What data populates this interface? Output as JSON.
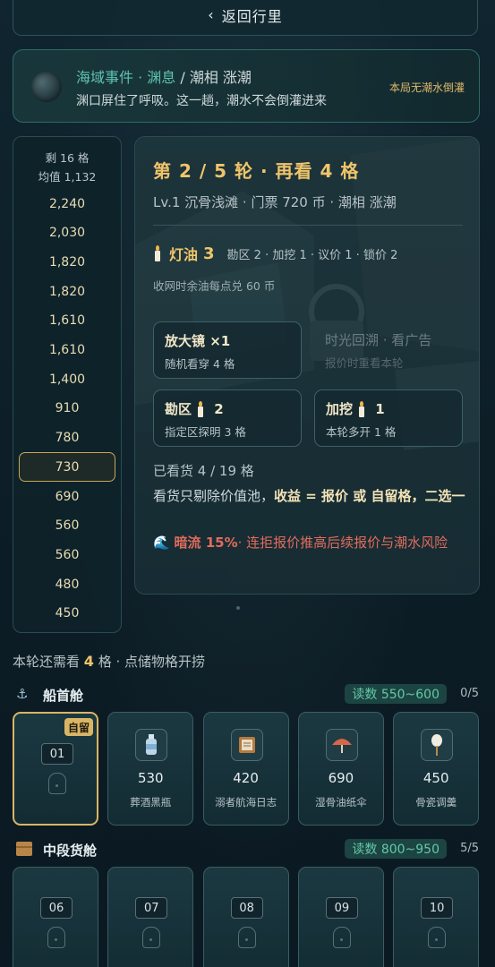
{
  "nav": {
    "back_label": "返回行里"
  },
  "event": {
    "title_prefix": "海域事件 · 渊息",
    "title_suffix": " / 潮相 涨潮",
    "desc": "渊口屏住了呼吸。这一趟，潮水不会倒灌进来",
    "side_note": "本局无潮水倒灌"
  },
  "price_column": {
    "remaining": "剩 16 格",
    "average": "均值 1,132",
    "prices": [
      "2,240",
      "2,030",
      "1,820",
      "1,820",
      "1,610",
      "1,610",
      "1,400",
      "910",
      "780",
      "730",
      "690",
      "560",
      "560",
      "480",
      "450"
    ],
    "selected_index": 9
  },
  "round": {
    "title": "第 2 / 5 轮 · 再看 4 格",
    "subtitle": "Lv.1 沉骨浅滩 · 门票 720 币 · 潮相 涨潮",
    "oil_label": "灯油",
    "oil_value": "3",
    "oil_costs": "勘区 2 · 加挖 1 · 议价 1 · 锁价 2",
    "oil_note": "收网时余油每点兑 60 币"
  },
  "tools": [
    {
      "title": "放大镜 ×1",
      "desc": "随机看穿 4 格",
      "cost": ""
    },
    {
      "title": "时光回溯 · 看广告",
      "desc": "报价时重看本轮",
      "cost": ""
    },
    {
      "title": "勘区",
      "desc": "指定区探明 3 格",
      "cost": "2"
    },
    {
      "title": "加挖",
      "desc": "本轮多开 1 格",
      "cost": "1"
    }
  ],
  "info": {
    "seen": "已看货 4 / 19 格",
    "rule_prefix": "看货只剔除价值池，",
    "rule_bold": "收益 = 报价 或 自留格，二选一",
    "risk_icon": "🌊",
    "risk_bold": "暗流 15%",
    "risk_text": "· 连拒报价推高后续报价与潮水风险"
  },
  "remain": {
    "prefix": "本轮还需看 ",
    "count": "4",
    "unit": " 格",
    "suffix": " · 点储物格开捞"
  },
  "sections": [
    {
      "icon": "anchor-icon",
      "title": "船首舱",
      "range": "读数 550~600",
      "count": "0/5",
      "slots": [
        {
          "type": "locked",
          "num": "01",
          "tag": "自留"
        },
        {
          "type": "item",
          "price": "530",
          "name": "葬酒黑瓶",
          "icon": "bottle-icon"
        },
        {
          "type": "item",
          "price": "420",
          "name": "溺者航海日志",
          "icon": "logbook-icon"
        },
        {
          "type": "item",
          "price": "690",
          "name": "湿骨油纸伞",
          "icon": "umbrella-icon"
        },
        {
          "type": "item",
          "price": "450",
          "name": "骨瓷调羹",
          "icon": "spoon-icon"
        }
      ]
    },
    {
      "icon": "crate-icon",
      "title": "中段货舱",
      "range": "读数 800~950",
      "count": "5/5",
      "slots": [
        {
          "type": "locked",
          "num": "06"
        },
        {
          "type": "locked",
          "num": "07"
        },
        {
          "type": "locked",
          "num": "08"
        },
        {
          "type": "locked",
          "num": "09"
        },
        {
          "type": "locked",
          "num": "10"
        }
      ]
    }
  ],
  "colors": {
    "accent_gold": "#f0c56a",
    "accent_teal": "#5fc3b2",
    "risk_red": "#e16c5c",
    "selected_border": "#d9b565"
  }
}
